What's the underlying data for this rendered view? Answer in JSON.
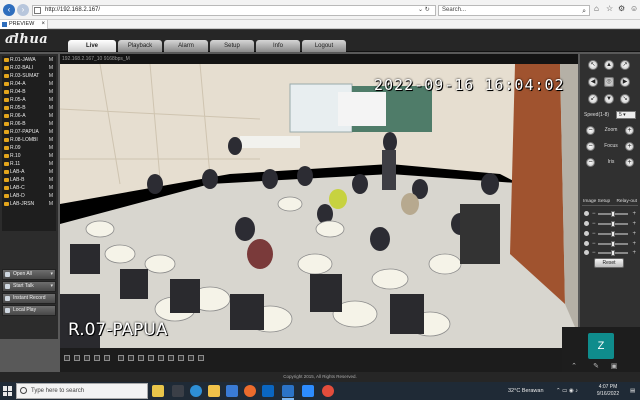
{
  "browser": {
    "address": "http://192.168.2.167/",
    "search_placeholder": "Search...",
    "tab_title": "PREVIEW"
  },
  "app": {
    "logo": "alhua",
    "nav": [
      "Live",
      "Playback",
      "Alarm",
      "Setup",
      "Info",
      "Logout"
    ],
    "active_nav": "Live",
    "footer": "Copyright 2015, All Rights Reserved."
  },
  "channels": [
    {
      "name": "R.01-JAWA",
      "m": "M"
    },
    {
      "name": "R.02-BALI",
      "m": "M"
    },
    {
      "name": "R.03-SUMAT",
      "m": "M"
    },
    {
      "name": "R.04-A",
      "m": "M"
    },
    {
      "name": "R.04-B",
      "m": "M"
    },
    {
      "name": "R.05-A",
      "m": "M"
    },
    {
      "name": "R.05-B",
      "m": "M"
    },
    {
      "name": "R.06-A",
      "m": "M"
    },
    {
      "name": "R.06-B",
      "m": "M"
    },
    {
      "name": "R.07-PAPUA",
      "m": "M"
    },
    {
      "name": "R.08-LOMBI",
      "m": "M"
    },
    {
      "name": "R.09",
      "m": "M"
    },
    {
      "name": "R.10",
      "m": "M"
    },
    {
      "name": "R.11",
      "m": "M"
    },
    {
      "name": "LAB-A",
      "m": "M"
    },
    {
      "name": "LAB-B",
      "m": "M"
    },
    {
      "name": "LAB-C",
      "m": "M"
    },
    {
      "name": "LAB-D",
      "m": "M"
    },
    {
      "name": "LAB-JRSN",
      "m": "M"
    }
  ],
  "channel_actions": {
    "open_all": "Open All",
    "start_talk": "Start Talk",
    "instant_record": "Instant Record",
    "local_play": "Local Play"
  },
  "video": {
    "info": "192.168.2.167_10 9168bps_M",
    "timestamp": "2022-09-16 16:04:02",
    "camera_label": "R.07-PAPUA"
  },
  "ptz": {
    "speed_label": "Speed(1-8)",
    "speed_value": "5",
    "zoom": "Zoom",
    "focus": "Focus",
    "iris": "Iris",
    "image_setup": "Image Setup",
    "relay_out": "Relay-out",
    "reset": "Reset",
    "sliders": [
      0.5,
      0.5,
      0.5,
      0.5,
      0.5
    ]
  },
  "overlay": {
    "initial": "Z"
  },
  "taskbar": {
    "search": "Type here to search",
    "weather": "32°C  Berawan",
    "time": "4:07 PM",
    "date": "9/16/2022"
  },
  "colors": {
    "accent_blue": "#2f6ebd",
    "channel_icon": "#e3a51c",
    "overlay_teal": "#0f8c8c"
  }
}
